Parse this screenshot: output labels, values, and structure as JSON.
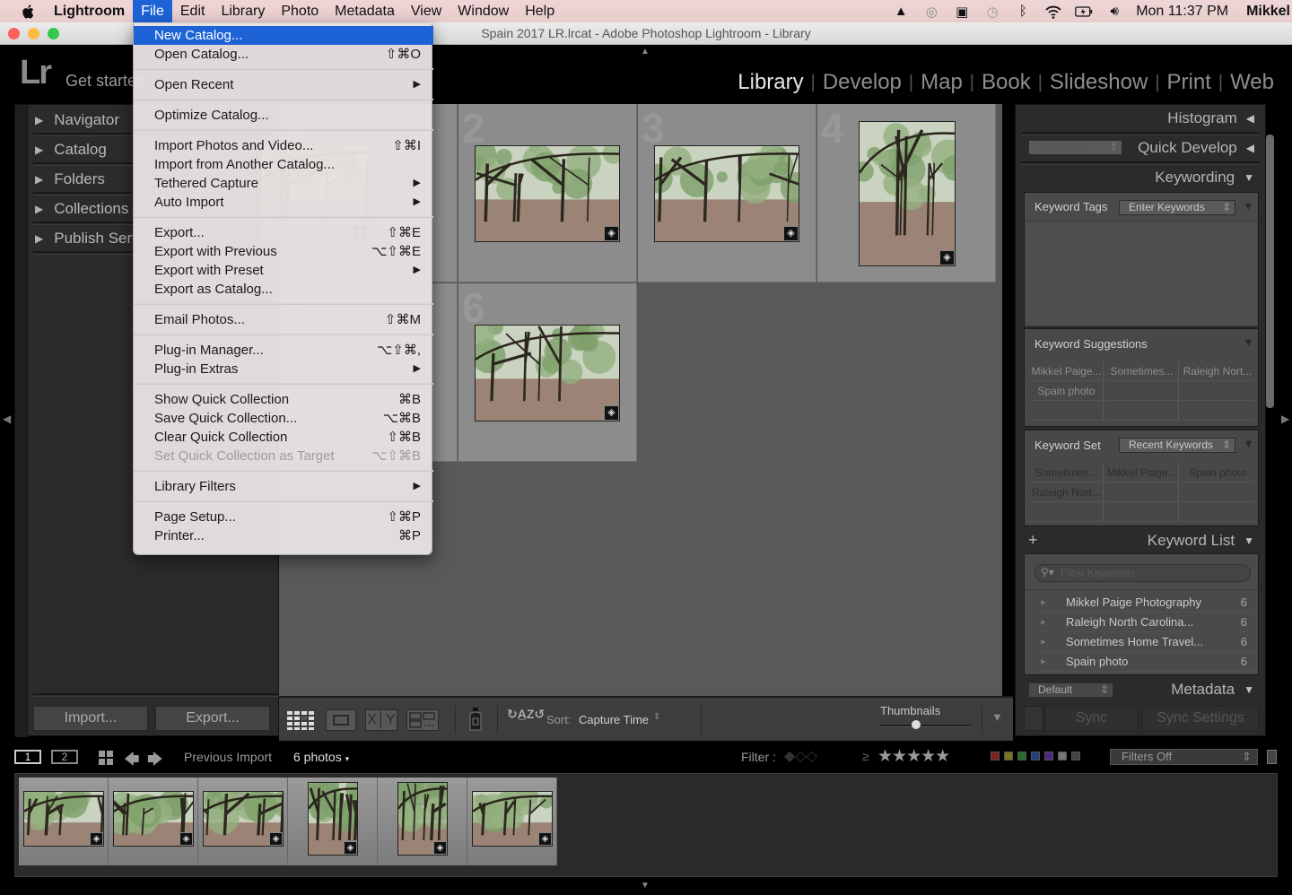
{
  "menubar": {
    "app_name": "Lightroom",
    "items": [
      "File",
      "Edit",
      "Library",
      "Photo",
      "Metadata",
      "View",
      "Window",
      "Help"
    ],
    "active_item": "File",
    "clock": "Mon 11:37 PM",
    "user": "Mikkel",
    "status_icons": [
      "google-drive-icon",
      "creative-cloud-icon",
      "display-icon",
      "time-machine-icon",
      "bluetooth-icon",
      "wifi-icon",
      "battery-icon",
      "volume-icon"
    ]
  },
  "window": {
    "title": "Spain 2017 LR.lrcat - Adobe Photoshop Lightroom - Library"
  },
  "header": {
    "logo": "Lr",
    "identity_plate": "Get started",
    "modules": [
      "Library",
      "Develop",
      "Map",
      "Book",
      "Slideshow",
      "Print",
      "Web"
    ],
    "active_module": "Library"
  },
  "file_menu": {
    "items": [
      {
        "label": "New Catalog...",
        "shortcut": "",
        "highlighted": true
      },
      {
        "label": "Open Catalog...",
        "shortcut": "⇧⌘O"
      },
      {
        "label": "Open Recent",
        "submenu": true
      },
      {
        "label": "Optimize Catalog...",
        "shortcut": ""
      },
      {
        "label": "Import Photos and Video...",
        "shortcut": "⇧⌘I"
      },
      {
        "label": "Import from Another Catalog...",
        "shortcut": ""
      },
      {
        "label": "Tethered Capture",
        "submenu": true
      },
      {
        "label": "Auto Import",
        "submenu": true
      },
      {
        "label": "Export...",
        "shortcut": "⇧⌘E"
      },
      {
        "label": "Export with Previous",
        "shortcut": "⌥⇧⌘E"
      },
      {
        "label": "Export with Preset",
        "submenu": true
      },
      {
        "label": "Export as Catalog...",
        "shortcut": ""
      },
      {
        "label": "Email Photos...",
        "shortcut": "⇧⌘M"
      },
      {
        "label": "Plug-in Manager...",
        "shortcut": "⌥⇧⌘,"
      },
      {
        "label": "Plug-in Extras",
        "submenu": true
      },
      {
        "label": "Show Quick Collection",
        "shortcut": "⌘B"
      },
      {
        "label": "Save Quick Collection...",
        "shortcut": "⌥⌘B"
      },
      {
        "label": "Clear Quick Collection",
        "shortcut": "⇧⌘B"
      },
      {
        "label": "Set Quick Collection as Target",
        "shortcut": "⌥⇧⌘B",
        "disabled": true
      },
      {
        "label": "Library Filters",
        "submenu": true
      },
      {
        "label": "Page Setup...",
        "shortcut": "⇧⌘P"
      },
      {
        "label": "Printer...",
        "shortcut": "⌘P"
      }
    ],
    "submenu_glyph": "▶"
  },
  "left_panel": {
    "sections": [
      "Navigator",
      "Catalog",
      "Folders",
      "Collections",
      "Publish Services"
    ],
    "import_button": "Import...",
    "export_button": "Export..."
  },
  "grid": {
    "cells": [
      {
        "number": "1"
      },
      {
        "number": "2"
      },
      {
        "number": "3"
      },
      {
        "number": "4"
      },
      {
        "number": "5"
      },
      {
        "number": "6"
      }
    ]
  },
  "toolbar": {
    "sort_label": "Sort:",
    "sort_value": "Capture Time",
    "thumbnails_label": "Thumbnails",
    "thumbnail_size": 0.4
  },
  "right_panel": {
    "histogram": "Histogram",
    "quick_develop": "Quick Develop",
    "quick_develop_preset": "Lightroom...",
    "keywording": "Keywording",
    "keyword_tags_label": "Keyword Tags",
    "keyword_tags_value": "Enter Keywords",
    "keyword_suggestions_label": "Keyword Suggestions",
    "keyword_suggestions": [
      "Mikkel Paige...",
      "Sometimes...",
      "Raleigh Nort...",
      "Spain photo"
    ],
    "keyword_set_label": "Keyword Set",
    "keyword_set_value": "Recent Keywords",
    "keyword_set": [
      "Sometimes...",
      "Mikkel Paige...",
      "Spain photo",
      "Raleigh Nort..."
    ],
    "keyword_list": "Keyword List",
    "filter_placeholder": "Filter Keywords",
    "keywords": [
      {
        "name": "Mikkel Paige Photography",
        "count": "6"
      },
      {
        "name": "Raleigh North Carolina...",
        "count": "6"
      },
      {
        "name": "Sometimes Home Travel...",
        "count": "6"
      },
      {
        "name": "Spain photo",
        "count": "6"
      }
    ],
    "metadata_preset": "Default",
    "metadata": "Metadata",
    "sync": "Sync",
    "sync_settings": "Sync Settings"
  },
  "filmstrip_bar": {
    "monitor1": "1",
    "monitor2": "2",
    "source": "Previous Import",
    "count": "6 photos",
    "filter_label": "Filter :",
    "rating_op": "≥",
    "stars": "★★★★★",
    "color_labels": [
      "#7a2222",
      "#7a7422",
      "#2a6a2a",
      "#22407a",
      "#4a2a7a",
      "#777777",
      "#444444"
    ],
    "filters_value": "Filters Off"
  }
}
